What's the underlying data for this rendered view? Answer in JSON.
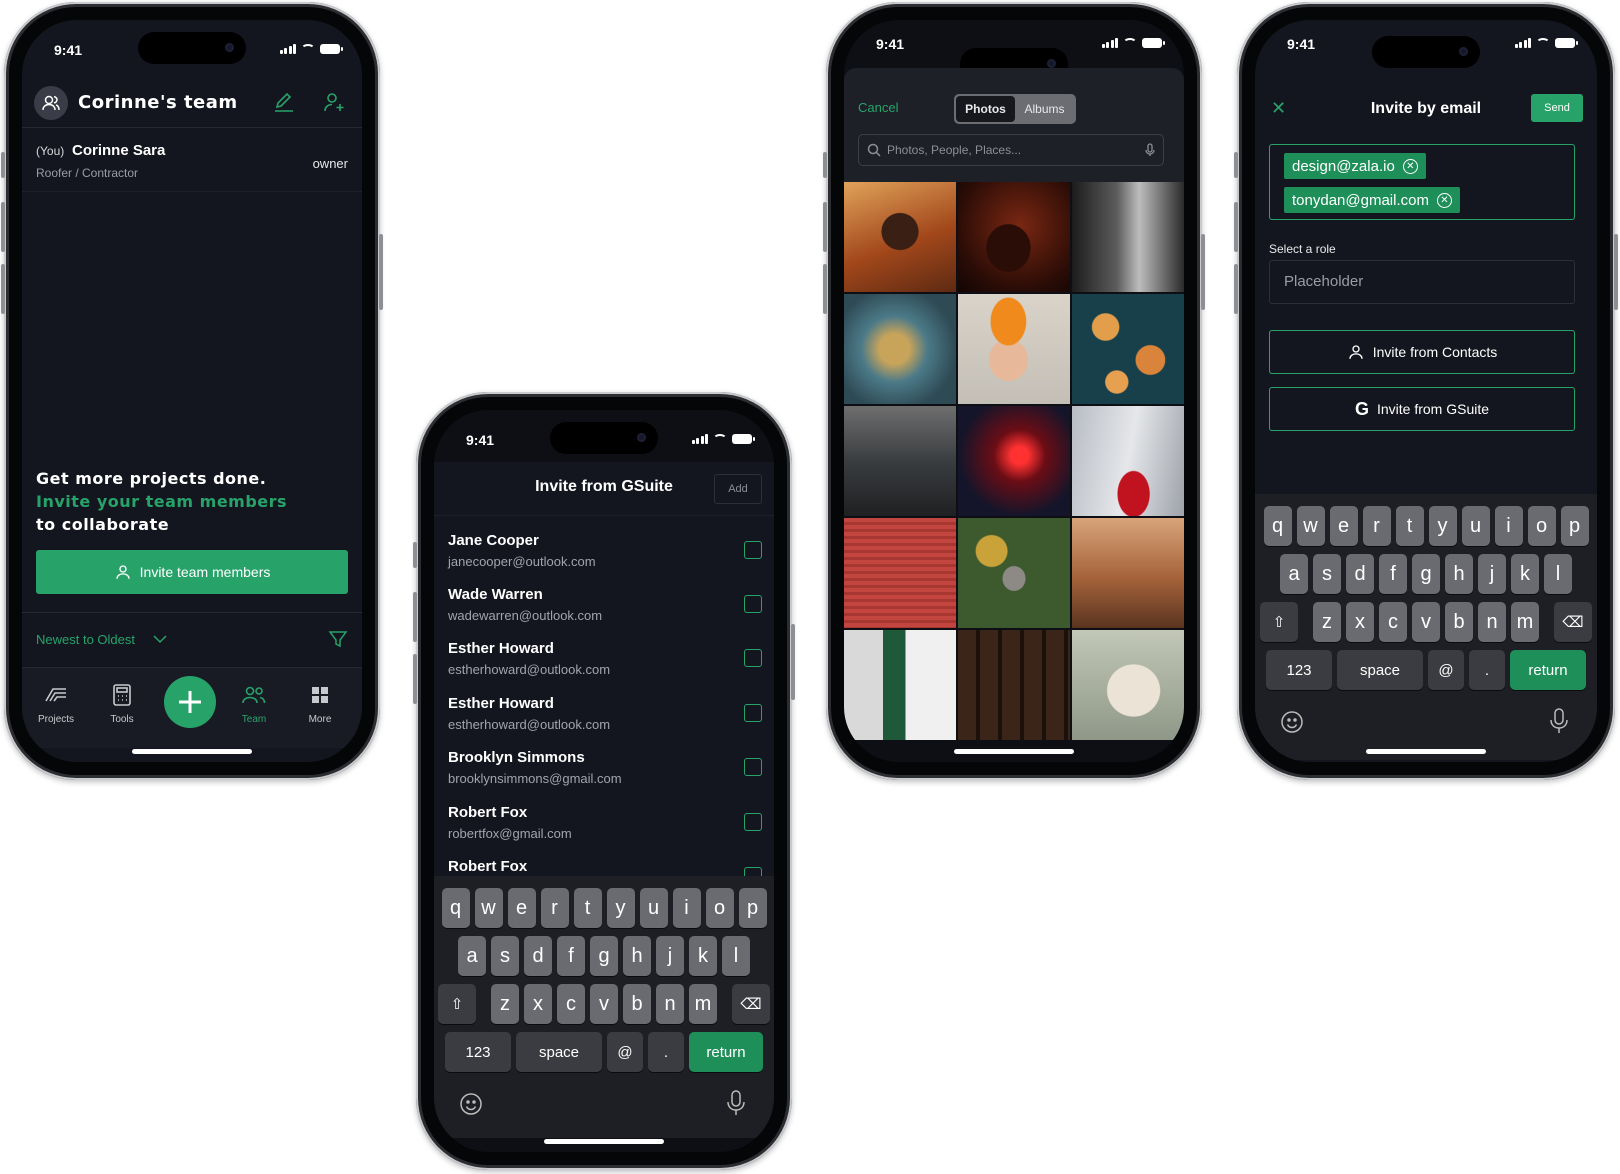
{
  "status_time": "9:41",
  "colors": {
    "accent": "#27a36a",
    "background": "#14161f",
    "keyboard": "#1e1f24"
  },
  "team_screen": {
    "title": "Corinne's team",
    "header_icons": [
      "edit-icon",
      "add-user-icon"
    ],
    "member": {
      "you_tag": "(You)",
      "name": "Corinne Sara",
      "role": "Roofer / Contractor",
      "badge": "owner"
    },
    "promo": {
      "line1": "Get more projects done.",
      "line2": "Invite your team members",
      "line3": "to collaborate"
    },
    "cta_label": "Invite team members",
    "sort_label": "Newest to Oldest",
    "tabs": [
      {
        "label": "Projects",
        "icon": "projects-icon"
      },
      {
        "label": "Tools",
        "icon": "calculator-icon"
      },
      {
        "label": "Team",
        "icon": "team-icon",
        "active": true
      },
      {
        "label": "More",
        "icon": "grid-icon"
      }
    ]
  },
  "gsuite_screen": {
    "title": "Invite from GSuite",
    "add_label": "Add",
    "contacts": [
      {
        "name": "Jane Cooper",
        "email": "janecooper@outlook.com"
      },
      {
        "name": "Wade Warren",
        "email": "wadewarren@outlook.com"
      },
      {
        "name": "Esther Howard",
        "email": "estherhoward@outlook.com"
      },
      {
        "name": "Esther Howard",
        "email": "estherhoward@outlook.com"
      },
      {
        "name": "Brooklyn Simmons",
        "email": "brooklynsimmons@gmail.com"
      },
      {
        "name": "Robert Fox",
        "email": "robertfox@gmail.com"
      },
      {
        "name": "Robert Fox",
        "email": ""
      }
    ]
  },
  "photos_screen": {
    "cancel": "Cancel",
    "segments": [
      "Photos",
      "Albums"
    ],
    "search_placeholder": "Photos, People, Places..."
  },
  "email_screen": {
    "title": "Invite by email",
    "send": "Send",
    "chips": [
      "design@zala.io",
      "tonydan@gmail.com"
    ],
    "role_label": "Select a role",
    "role_placeholder": "Placeholder",
    "contacts_button": "Invite from Contacts",
    "gsuite_button": "Invite from GSuite"
  },
  "keyboard": {
    "row1": [
      "q",
      "w",
      "e",
      "r",
      "t",
      "y",
      "u",
      "i",
      "o",
      "p"
    ],
    "row2": [
      "a",
      "s",
      "d",
      "f",
      "g",
      "h",
      "j",
      "k",
      "l"
    ],
    "row3": [
      "z",
      "x",
      "c",
      "v",
      "b",
      "n",
      "m"
    ],
    "numbers": "123",
    "space": "space",
    "at": "@",
    "dot": ".",
    "return": "return"
  }
}
